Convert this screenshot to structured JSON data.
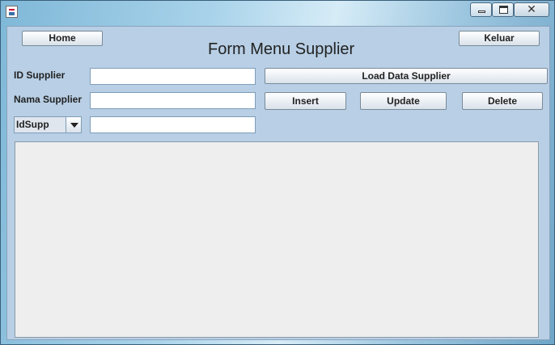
{
  "window": {
    "icon": "java-app-icon",
    "controls": {
      "minimize": "minimize-icon",
      "maximize": "maximize-icon",
      "close_glyph": "✕"
    }
  },
  "form": {
    "title": "Form Menu Supplier",
    "home_label": "Home",
    "exit_label": "Keluar",
    "id_label": "ID Supplier",
    "name_label": "Nama Supplier",
    "id_value": "",
    "name_value": "",
    "search_value": "",
    "load_label": "Load Data Supplier",
    "insert_label": "Insert",
    "update_label": "Update",
    "delete_label": "Delete",
    "combo": {
      "selected": "IdSupp"
    }
  },
  "table": {
    "rows": []
  }
}
